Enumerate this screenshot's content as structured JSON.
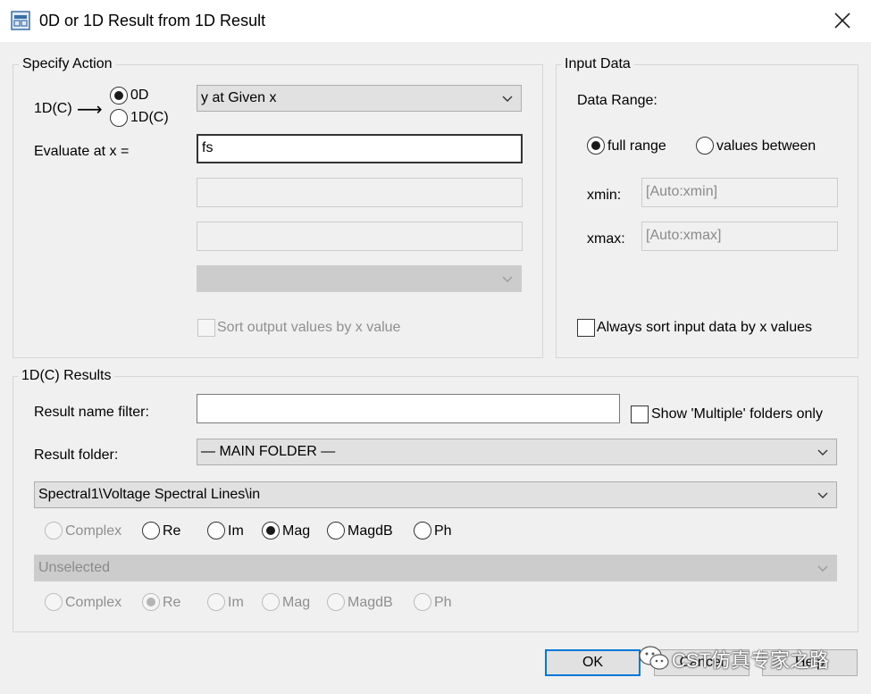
{
  "window": {
    "title": "0D or 1D Result from 1D Result",
    "icon": "dialog-app-icon",
    "close_icon": "close-icon"
  },
  "specify_action": {
    "group_label": "Specify Action",
    "prefix_label": "1D(C)",
    "arrow_glyph": "⟶",
    "output_options": [
      {
        "label": "0D",
        "checked": true
      },
      {
        "label": "1D(C)",
        "checked": false
      }
    ],
    "operation_select": "y at Given x",
    "evaluate_label": "Evaluate at x =",
    "evaluate_value": "fs",
    "extra_input_1": "",
    "extra_input_2": "",
    "extra_select": "",
    "sort_output_label": "Sort output values by x value",
    "sort_output_checked": false
  },
  "input_data": {
    "group_label": "Input Data",
    "data_range_label": "Data Range:",
    "range_options": [
      {
        "label": "full range",
        "checked": true
      },
      {
        "label": "values between",
        "checked": false
      }
    ],
    "xmin_label": "xmin:",
    "xmin_value": "[Auto:xmin]",
    "xmax_label": "xmax:",
    "xmax_value": "[Auto:xmax]",
    "always_sort_label": "Always sort input data by x values",
    "always_sort_checked": false
  },
  "results": {
    "group_label": "1D(C) Results",
    "filter_label": "Result name filter:",
    "filter_value": "",
    "show_multiple_label": "Show 'Multiple' folders only",
    "show_multiple_checked": false,
    "folder_label": "Result folder:",
    "folder_value": "— MAIN FOLDER —",
    "result1_value": "Spectral1\\Voltage Spectral Lines\\in",
    "result1_components": [
      {
        "label": "Complex",
        "checked": false,
        "disabled": true
      },
      {
        "label": "Re",
        "checked": false,
        "disabled": false
      },
      {
        "label": "Im",
        "checked": false,
        "disabled": false
      },
      {
        "label": "Mag",
        "checked": true,
        "disabled": false
      },
      {
        "label": "MagdB",
        "checked": false,
        "disabled": false
      },
      {
        "label": "Ph",
        "checked": false,
        "disabled": false
      }
    ],
    "result2_value": "Unselected",
    "result2_components": [
      {
        "label": "Complex",
        "checked": false,
        "disabled": true
      },
      {
        "label": "Re",
        "checked": true,
        "disabled": true
      },
      {
        "label": "Im",
        "checked": false,
        "disabled": true
      },
      {
        "label": "Mag",
        "checked": false,
        "disabled": true
      },
      {
        "label": "MagdB",
        "checked": false,
        "disabled": true
      },
      {
        "label": "Ph",
        "checked": false,
        "disabled": true
      }
    ]
  },
  "buttons": {
    "ok": "OK",
    "cancel": "Cancel",
    "help": "Help"
  },
  "watermark": {
    "text": "CST仿真专家之路",
    "icon": "wechat-icon"
  }
}
